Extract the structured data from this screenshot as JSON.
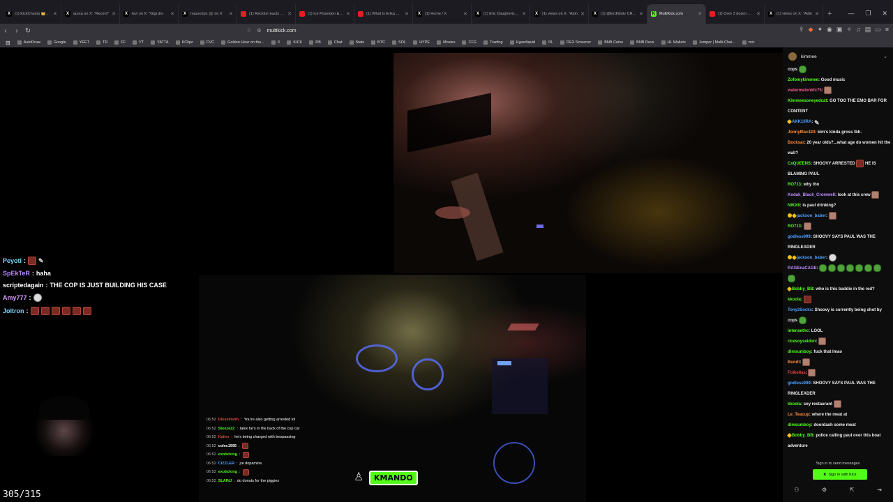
{
  "tabs": [
    {
      "favicon": "x-logo",
      "label": "(1) KickChamp 👑 on X",
      "active": false,
      "fav_class": "fav-x",
      "fav_glyph": "X"
    },
    {
      "favicon": "x-logo",
      "label": "aʟᴇxa on X: \"Recent\"",
      "active": false,
      "fav_class": "fav-x",
      "fav_glyph": "X"
    },
    {
      "favicon": "x-logo",
      "label": "levi on X: \"Gigi dro",
      "active": false,
      "fav_class": "fav-x",
      "fav_glyph": "X"
    },
    {
      "favicon": "x-logo",
      "label": "mazeclips 🎥 on X",
      "active": false,
      "fav_class": "fav-x",
      "fav_glyph": "X"
    },
    {
      "favicon": "youtube-logo",
      "label": "(1) Reckful reacts to d",
      "active": false,
      "fav_class": "fav-yt",
      "fav_glyph": ""
    },
    {
      "favicon": "youtube-logo",
      "label": "(1) Ice Poseidon & Ni",
      "active": false,
      "fav_class": "fav-yt",
      "fav_glyph": ""
    },
    {
      "favicon": "youtube-logo",
      "label": "(1) What Is Erika Kirk",
      "active": false,
      "fav_class": "fav-yt",
      "fav_glyph": ""
    },
    {
      "favicon": "x-logo",
      "label": "(1) Home / X",
      "active": false,
      "fav_class": "fav-x",
      "fav_glyph": "X"
    },
    {
      "favicon": "x-logo",
      "label": "(1) Eric Daugherty on",
      "active": false,
      "fav_class": "fav-x",
      "fav_glyph": "X"
    },
    {
      "favicon": "x-logo",
      "label": "(1) views on X: \"Adin",
      "active": false,
      "fav_class": "fav-x",
      "fav_glyph": "X"
    },
    {
      "favicon": "x-logo",
      "label": "(1) @lordhitotv CRASH",
      "active": false,
      "fav_class": "fav-x",
      "fav_glyph": "X"
    },
    {
      "favicon": "multikick-logo",
      "label": "MultiKick.com",
      "active": true,
      "fav_class": "fav-kick",
      "fav_glyph": "K"
    },
    {
      "favicon": "youtube-logo",
      "label": "(1) Over 3 dozen bod",
      "active": false,
      "fav_class": "fav-yt",
      "fav_glyph": ""
    },
    {
      "favicon": "x-logo",
      "label": "(1) views on X: \"Adin",
      "active": false,
      "fav_class": "fav-x",
      "fav_glyph": "X"
    }
  ],
  "url": "multikick.com",
  "bookmarks": [
    {
      "label": "AutoDraw",
      "icon": "autodraw-icon"
    },
    {
      "label": "Google",
      "icon": "google-icon"
    },
    {
      "label": "YEET",
      "icon": "bookmark-icon"
    },
    {
      "label": "TR",
      "icon": "bookmark-icon"
    },
    {
      "label": "FF",
      "icon": "bookmark-icon"
    },
    {
      "label": "YT",
      "icon": "youtube-icon"
    },
    {
      "label": "YATTA",
      "icon": "youtube-icon"
    },
    {
      "label": "KClipz",
      "icon": "youtube-icon"
    },
    {
      "label": "CVC",
      "icon": "youtube-icon"
    },
    {
      "label": "Golden Hour on the...",
      "icon": "youtube-icon"
    },
    {
      "label": "X",
      "icon": "x-icon"
    },
    {
      "label": "KICK",
      "icon": "kick-icon"
    },
    {
      "label": "DB",
      "icon": "kick-icon"
    },
    {
      "label": "Chat",
      "icon": "kick-icon"
    },
    {
      "label": "Stats",
      "icon": "stats-icon"
    },
    {
      "label": "BTC",
      "icon": "bookmark-icon"
    },
    {
      "label": "SOL",
      "icon": "bookmark-icon"
    },
    {
      "label": "HYPE",
      "icon": "bookmark-icon"
    },
    {
      "label": "Movies",
      "icon": "movie-icon"
    },
    {
      "label": "CFG",
      "icon": "bookmark-icon"
    },
    {
      "label": "Trading",
      "icon": "folder-icon"
    },
    {
      "label": "Hyperliquid",
      "icon": "bookmark-icon"
    },
    {
      "label": "DL",
      "icon": "bookmark-icon"
    },
    {
      "label": "DEX Screener",
      "icon": "bookmark-icon"
    },
    {
      "label": "BNB Coins",
      "icon": "folder-icon"
    },
    {
      "label": "BNB Devs",
      "icon": "folder-icon"
    },
    {
      "label": "HL Wallets",
      "icon": "folder-icon"
    },
    {
      "label": "Jumper | Multi-Chai...",
      "icon": "bookmark-icon"
    },
    {
      "label": "mic",
      "icon": "bookmark-icon"
    }
  ],
  "left_overlay": [
    {
      "user": "Peyoti",
      "color": "#7fd9ff",
      "text": "",
      "emotes": [
        "emote",
        "glyph"
      ]
    },
    {
      "user": "SpEkTeR",
      "color": "#c08cff",
      "text": "haha",
      "emotes": []
    },
    {
      "user": "scriptedagain",
      "color": "#ffffff",
      "text": "THE COP IS JUST BUILDING HIS CASE",
      "emotes": []
    },
    {
      "user": "Amy777",
      "color": "#d99cff",
      "text": "",
      "emotes": [
        "skull"
      ]
    },
    {
      "user": "Joltron",
      "color": "#7fd9ff",
      "text": "",
      "emotes": [
        "emote",
        "emote",
        "emote",
        "emote",
        "emote",
        "emote"
      ]
    }
  ],
  "counter": "305/315",
  "video_chat": [
    {
      "time": "06:52",
      "user": "Dieselmeth",
      "color": "#e0463c",
      "text": "You're also getting arrested lol"
    },
    {
      "time": "06:52",
      "user": "Steeze22",
      "color": "#53fc18",
      "text": "lalex he's in the back of the cop car"
    },
    {
      "time": "06:52",
      "user": "Kaitor",
      "color": "#e0463c",
      "text": "he's being charged with trespassing"
    },
    {
      "time": "06:52",
      "user": "colec1995",
      "color": "#ffffff",
      "text": ""
    },
    {
      "time": "06:52",
      "user": "exoticking",
      "color": "#53fc18",
      "text": ""
    },
    {
      "time": "06:52",
      "user": "CIZZLER",
      "color": "#4ea1ff",
      "text": "jre dopamine"
    },
    {
      "time": "06:52",
      "user": "exoticking",
      "color": "#53fc18",
      "text": ""
    },
    {
      "time": "06:52",
      "user": "SLAINJ",
      "color": "#53fc18",
      "text": "do donuts for the piggies"
    }
  ],
  "kick_logo": "MANDO",
  "chat": {
    "channel": "kimmee",
    "messages": [
      {
        "user": "",
        "color": "#ffffff",
        "text": "cops",
        "badge": "",
        "emote": "pepe"
      },
      {
        "user": "Zofomykimmee",
        "color": "#53fc18",
        "text": "Good music",
        "badge": "",
        "emote": ""
      },
      {
        "user": "watermelonkfc75",
        "color": "#ff5a8a",
        "text": "",
        "badge": "",
        "emote": "face"
      },
      {
        "user": "Kimmeesoneyedcat",
        "color": "#53fc18",
        "text": "GO TOO THE EMO BAR FOR CONTENT",
        "badge": "",
        "emote": ""
      },
      {
        "user": "AKK1IIRA",
        "color": "#4ea1ff",
        "text": "",
        "badge": "star",
        "emote": "glyph"
      },
      {
        "user": "JonnyMac420",
        "color": "#ff8a3d",
        "text": "kim's kinda gross tbh.",
        "badge": "",
        "emote": ""
      },
      {
        "user": "Bocksar",
        "color": "#ff8a3d",
        "text": "20 year olds?...what age do women hit the wall?",
        "badge": "",
        "emote": ""
      },
      {
        "user": "CxQUEENS",
        "color": "#53fc18",
        "text": "SHOOVY ARRESTED",
        "badge": "",
        "emote": "emote",
        "after": "HE IS BLAMING PAUL"
      },
      {
        "user": "RO713",
        "color": "#53fc18",
        "text": "why tho",
        "badge": "",
        "emote": ""
      },
      {
        "user": "Kodak_Black_Cromwell",
        "color": "#c08cff",
        "text": "look at this crew",
        "badge": "",
        "emote": "face"
      },
      {
        "user": "NIKX6",
        "color": "#53fc18",
        "text": "is paul drinking?",
        "badge": "",
        "emote": ""
      },
      {
        "user": "jackson_baber",
        "color": "#4ea1ff",
        "text": "",
        "badge": "dual",
        "emote": "face"
      },
      {
        "user": "RO713",
        "color": "#53fc18",
        "text": "",
        "badge": "",
        "emote": "face"
      },
      {
        "user": "godless999",
        "color": "#4ea1ff",
        "text": "SHOOVY SAYS PAUL WAS THE RINGLEADER",
        "badge": "",
        "emote": ""
      },
      {
        "user": "jackson_baber",
        "color": "#4ea1ff",
        "text": "",
        "badge": "dual",
        "emote": "skull"
      },
      {
        "user": "RAGEnaCAGE",
        "color": "#c08cff",
        "text": "",
        "badge": "",
        "emote": "kickrow"
      },
      {
        "user": "Bobby_BB",
        "color": "#53fc18",
        "text": "who is this baddie in the red?",
        "badge": "star",
        "emote": ""
      },
      {
        "user": "kkoola",
        "color": "#53fc18",
        "text": "",
        "badge": "",
        "emote": "emote"
      },
      {
        "user": "Tony2Socks",
        "color": "#4ea1ff",
        "text": "Shoovy is currently being shot by cops",
        "badge": "",
        "emote": "pepe"
      },
      {
        "user": "intensethc",
        "color": "#53fc18",
        "text": "LOOL",
        "badge": "",
        "emote": ""
      },
      {
        "user": "ricesoyseidon",
        "color": "#53fc18",
        "text": "",
        "badge": "",
        "emote": "face"
      },
      {
        "user": "dimsumboy",
        "color": "#53fc18",
        "text": "fuck that lmao",
        "badge": "",
        "emote": ""
      },
      {
        "user": "Bundt",
        "color": "#ff8a3d",
        "text": "",
        "badge": "",
        "emote": "face"
      },
      {
        "user": "Folkellas",
        "color": "#e0463c",
        "text": "",
        "badge": "",
        "emote": "face"
      },
      {
        "user": "godless999",
        "color": "#4ea1ff",
        "text": "SHOOVY SAYS PAUL WAS THE RINGLEADER",
        "badge": "",
        "emote": ""
      },
      {
        "user": "kkoola",
        "color": "#53fc18",
        "text": "soy restaurant",
        "badge": "",
        "emote": "face"
      },
      {
        "user": "Le_Teacup",
        "color": "#ff8a3d",
        "text": "where the meat at",
        "badge": "",
        "emote": ""
      },
      {
        "user": "dimsumboy",
        "color": "#53fc18",
        "text": "doordash some meat",
        "badge": "",
        "emote": ""
      },
      {
        "user": "Bobby_BB",
        "color": "#53fc18",
        "text": "police calling paul over this boat adventure",
        "badge": "star",
        "emote": ""
      }
    ],
    "signin_text": "Sign in to send messages",
    "signin_button": "Sign in with Kick"
  }
}
